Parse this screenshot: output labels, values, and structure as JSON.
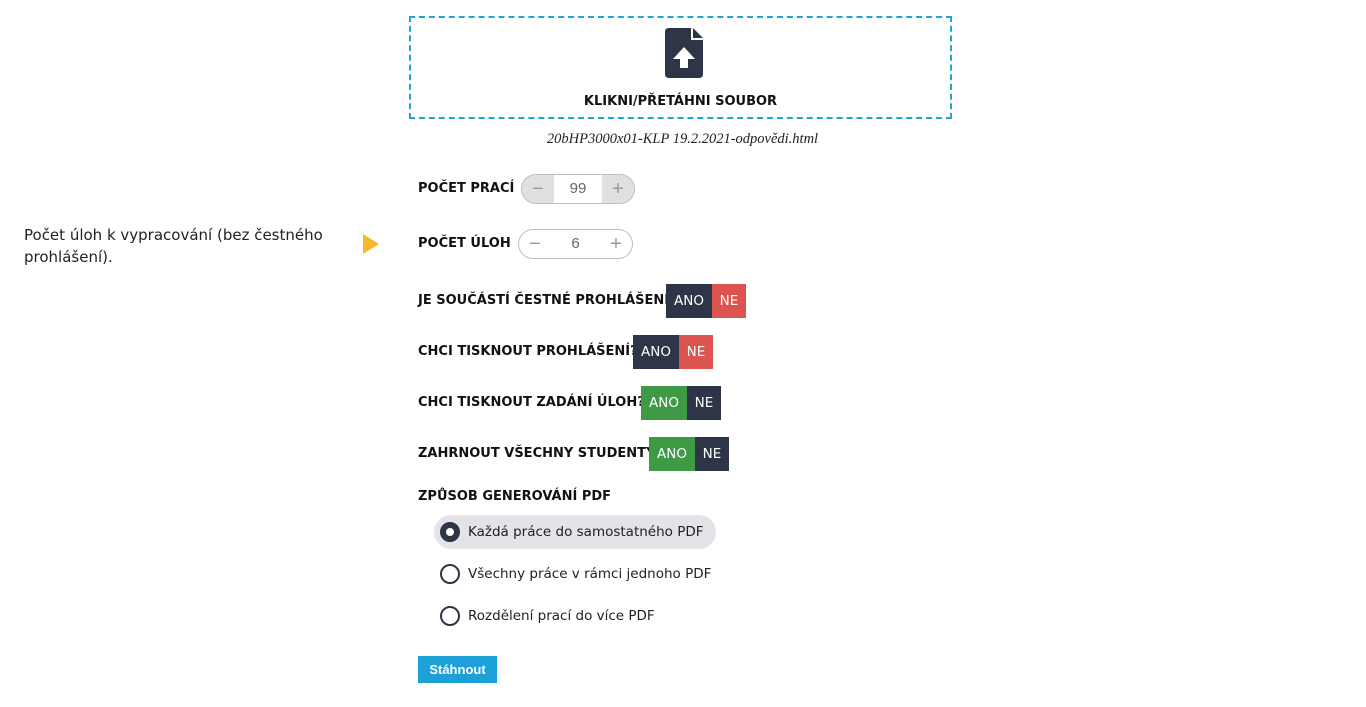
{
  "upload": {
    "label": "KLIKNI/PŘETÁHNI SOUBOR",
    "filename": "20bHP3000x01-KLP 19.2.2021-odpovědi.html"
  },
  "side_note": "Počet úloh k vypracování (bez čestného prohlášení).",
  "pocet_praci": {
    "label": "POČET PRACÍ",
    "value": "99",
    "minus": "−",
    "plus": "+"
  },
  "pocet_uloh": {
    "label": "POČET ÚLOH",
    "value": "6",
    "minus": "−",
    "plus": "+"
  },
  "toggles": [
    {
      "label": "JE SOUČÁSTÍ ČESTNÉ PROHLÁŠENÍ?",
      "yes": "ANO",
      "no": "NE",
      "selected": "NE"
    },
    {
      "label": "CHCI TISKNOUT PROHLÁŠENÍ?",
      "yes": "ANO",
      "no": "NE",
      "selected": "NE"
    },
    {
      "label": "CHCI TISKNOUT ZADÁNÍ ÚLOH?",
      "yes": "ANO",
      "no": "NE",
      "selected": "ANO"
    },
    {
      "label": "ZAHRNOUT VŠECHNY STUDENTY",
      "yes": "ANO",
      "no": "NE",
      "selected": "ANO"
    }
  ],
  "pdf_mode": {
    "label": "ZPŮSOB GENEROVÁNÍ PDF",
    "options": [
      "Každá práce do samostatného PDF",
      "Všechny práce v rámci jednoho PDF",
      "Rozdělení prací do více PDF"
    ],
    "selected_index": 0
  },
  "download_label": "Stáhnout",
  "colors": {
    "accent": "#1da0d8",
    "navy": "#2d3547",
    "red": "#dc5350",
    "green": "#3f9a45",
    "arrow": "#f5b82e"
  }
}
